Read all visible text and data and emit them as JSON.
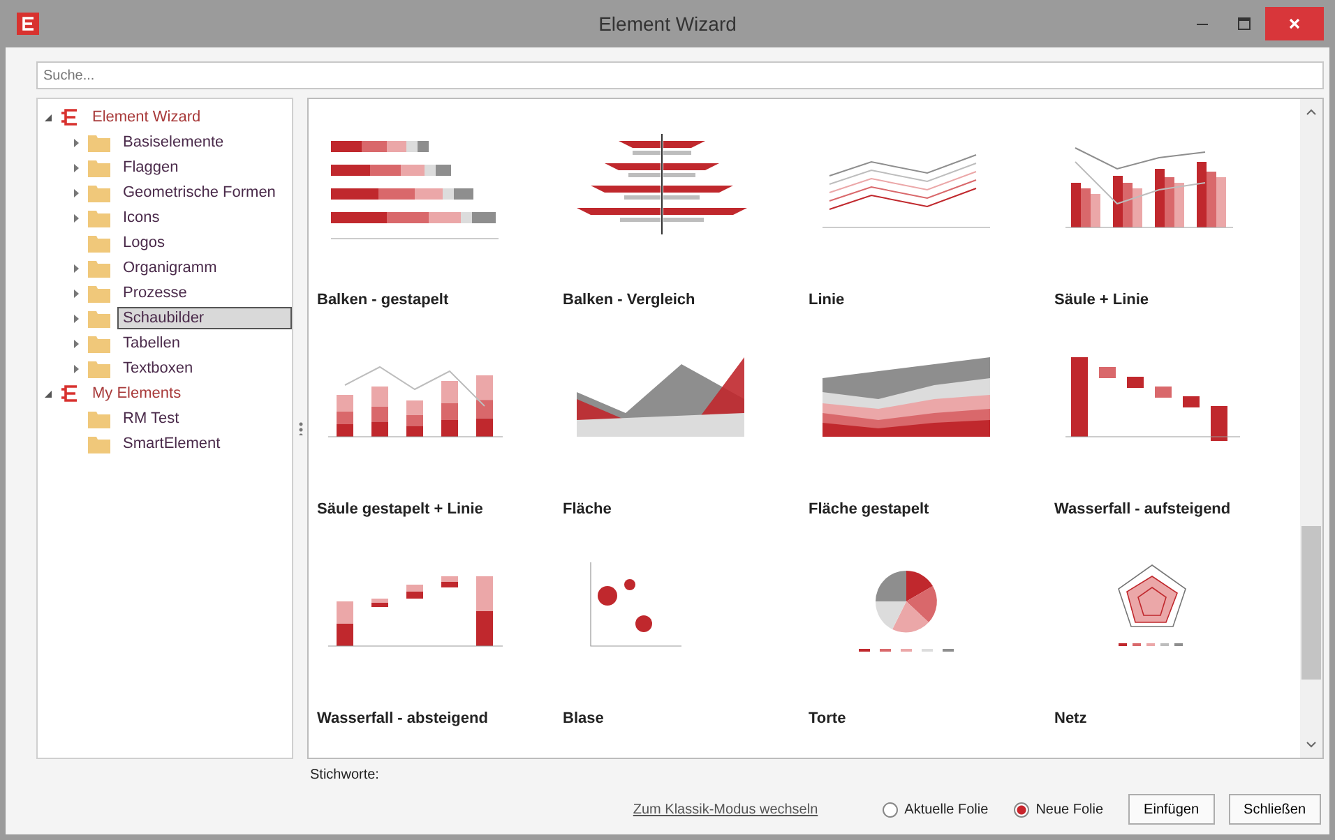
{
  "window": {
    "title": "Element Wizard"
  },
  "search": {
    "placeholder": "Suche..."
  },
  "tree": [
    {
      "label": "Element Wizard",
      "expanded": true,
      "selected": false,
      "children": [
        {
          "label": "Basiselemente",
          "kind": "branch",
          "selected": false
        },
        {
          "label": "Flaggen",
          "kind": "branch",
          "selected": false
        },
        {
          "label": "Geometrische Formen",
          "kind": "branch",
          "selected": false
        },
        {
          "label": "Icons",
          "kind": "branch",
          "selected": false
        },
        {
          "label": "Logos",
          "kind": "leaf",
          "selected": false
        },
        {
          "label": "Organigramm",
          "kind": "branch",
          "selected": false
        },
        {
          "label": "Prozesse",
          "kind": "branch",
          "selected": false
        },
        {
          "label": "Schaubilder",
          "kind": "branch",
          "selected": true
        },
        {
          "label": "Tabellen",
          "kind": "branch",
          "selected": false
        },
        {
          "label": "Textboxen",
          "kind": "branch",
          "selected": false
        }
      ]
    },
    {
      "label": "My Elements",
      "expanded": true,
      "selected": false,
      "children": [
        {
          "label": "RM Test",
          "kind": "leaf",
          "selected": false
        },
        {
          "label": "SmartElement",
          "kind": "leaf",
          "selected": false
        }
      ]
    }
  ],
  "gallery": [
    {
      "label": "Balken - gestapelt",
      "kind": "stacked-bar"
    },
    {
      "label": "Balken - Vergleich",
      "kind": "bar-compare"
    },
    {
      "label": "Linie",
      "kind": "line"
    },
    {
      "label": "Säule + Linie",
      "kind": "column-line"
    },
    {
      "label": "Säule gestapelt + Linie",
      "kind": "stacked-column-line"
    },
    {
      "label": "Fläche",
      "kind": "area"
    },
    {
      "label": "Fläche gestapelt",
      "kind": "stacked-area"
    },
    {
      "label": "Wasserfall - aufsteigend",
      "kind": "waterfall"
    },
    {
      "label": "Wasserfall - absteigend",
      "kind": "waterfall-down"
    },
    {
      "label": "Blase",
      "kind": "bubble"
    },
    {
      "label": "Torte",
      "kind": "pie"
    },
    {
      "label": "Netz",
      "kind": "radar"
    }
  ],
  "keywords_label": "Stichworte:",
  "footer": {
    "link": "Zum Klassik-Modus wechseln",
    "options": [
      {
        "label": "Aktuelle Folie",
        "selected": false
      },
      {
        "label": "Neue Folie",
        "selected": true
      }
    ],
    "buttons": [
      "Einfügen",
      "Schließen"
    ]
  }
}
